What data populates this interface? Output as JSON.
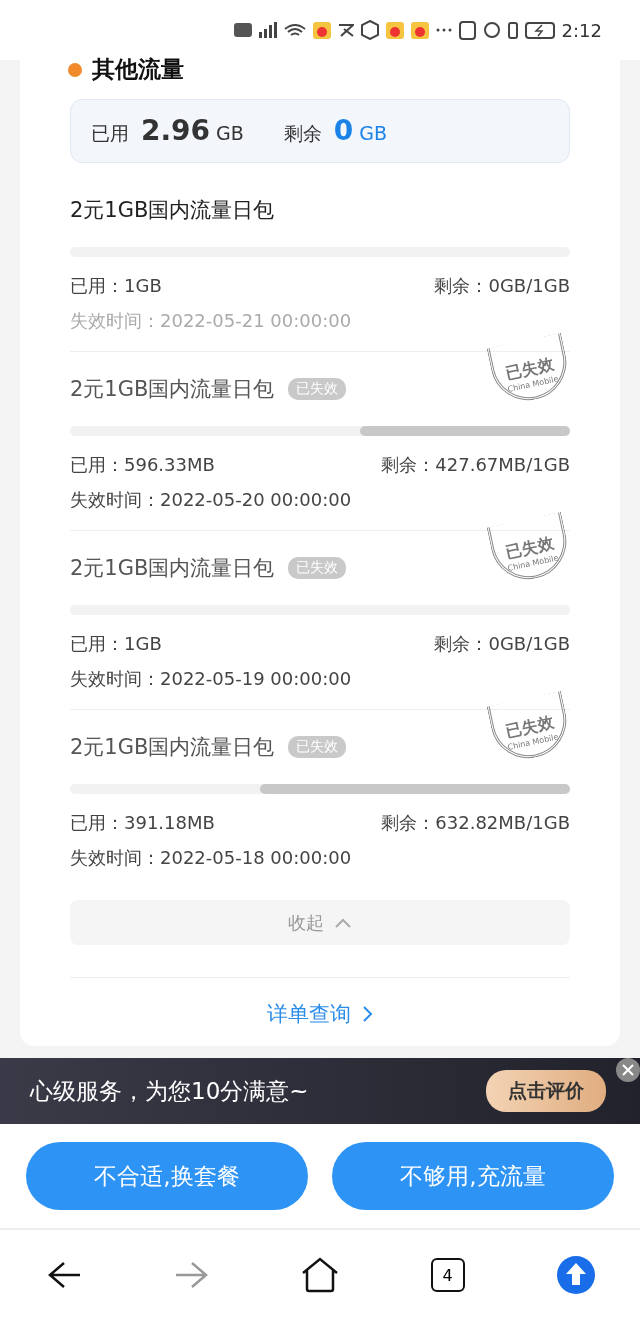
{
  "status_bar": {
    "time": "2:12"
  },
  "section": {
    "title": "其他流量",
    "summary": {
      "used_label": "已用",
      "used_value": "2.96",
      "used_unit": "GB",
      "remain_label": "剩余",
      "remain_value": "0",
      "remain_unit": "GB"
    }
  },
  "packages": [
    {
      "name": "2元1GB国内流量日包",
      "expired": false,
      "level": 0,
      "used": "已用：1GB",
      "remaining": "剩余：0GB/1GB",
      "expiry": "失效时间：2022-05-21 00:00:00"
    },
    {
      "name": "2元1GB国内流量日包",
      "expired": true,
      "badge": "已失效",
      "stamp": "已失效",
      "stamp_sub": "China Mobile",
      "level": 0.42,
      "used": "已用：596.33MB",
      "remaining": "剩余：427.67MB/1GB",
      "expiry": "失效时间：2022-05-20 00:00:00"
    },
    {
      "name": "2元1GB国内流量日包",
      "expired": true,
      "badge": "已失效",
      "stamp": "已失效",
      "stamp_sub": "China Mobile",
      "level": 0,
      "used": "已用：1GB",
      "remaining": "剩余：0GB/1GB",
      "expiry": "失效时间：2022-05-19 00:00:00"
    },
    {
      "name": "2元1GB国内流量日包",
      "expired": true,
      "badge": "已失效",
      "stamp": "已失效",
      "stamp_sub": "China Mobile",
      "level": 0.62,
      "used": "已用：391.18MB",
      "remaining": "剩余：632.82MB/1GB",
      "expiry": "失效时间：2022-05-18 00:00:00"
    }
  ],
  "collapse_button": "收起",
  "detail_link": "详单查询",
  "banner": {
    "text": "心级服务，为您10分满意~",
    "button": "点击评价"
  },
  "actions": [
    "不合适,换套餐",
    "不够用,充流量"
  ],
  "browser_nav": {
    "tab_count": "4"
  }
}
